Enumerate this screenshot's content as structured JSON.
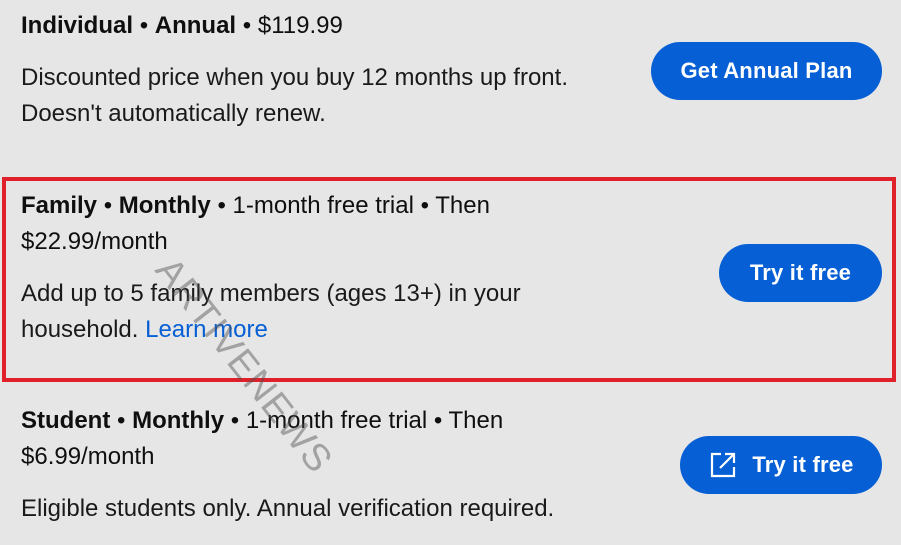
{
  "plans": [
    {
      "name": "Individual",
      "period": "Annual",
      "detail": "$119.99",
      "description": "Discounted price when you buy 12 months up front. Doesn't automatically renew.",
      "button_label": "Get Annual Plan"
    },
    {
      "name": "Family",
      "period": "Monthly",
      "detail": "1-month free trial • Then $22.99/month",
      "description": "Add up to 5 family members (ages 13+) in your household.",
      "link_label": "Learn more",
      "button_label": "Try it free"
    },
    {
      "name": "Student",
      "period": "Monthly",
      "detail": "1-month free trial • Then $6.99/month",
      "description": "Eligible students only. Annual verification required.",
      "button_label": "Try it free",
      "button_icon": "external-link-icon"
    }
  ],
  "separator": "•",
  "watermark": "ARTIVENEWS",
  "colors": {
    "button": "#065fd4",
    "link": "#065fd4",
    "highlight_border": "#e0202a",
    "background": "#e6e6e6"
  }
}
